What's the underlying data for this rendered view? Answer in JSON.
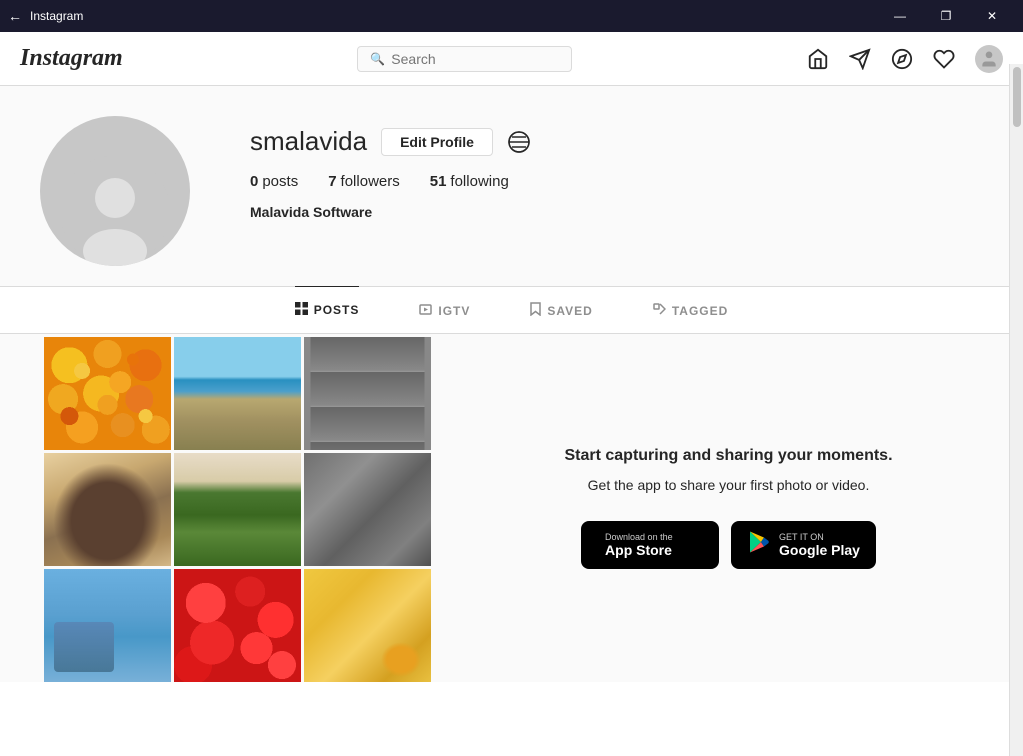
{
  "titleBar": {
    "appName": "Instagram",
    "backLabel": "←",
    "minimizeLabel": "—",
    "maximizeLabel": "❐",
    "closeLabel": "✕"
  },
  "topNav": {
    "logo": "Instagram",
    "search": {
      "placeholder": "Search",
      "value": ""
    },
    "icons": {
      "home": "⌂",
      "send": "▽",
      "explore": "◎",
      "heart": "♡"
    }
  },
  "profile": {
    "username": "smalavida",
    "editButton": "Edit Profile",
    "posts": {
      "count": "0",
      "label": "posts"
    },
    "followers": {
      "count": "7",
      "label": "followers"
    },
    "following": {
      "count": "51",
      "label": "following"
    },
    "displayName": "Malavida Software"
  },
  "tabs": {
    "posts": {
      "label": "POSTS",
      "icon": "⊞"
    },
    "igtv": {
      "label": "IGTV",
      "icon": "▶"
    },
    "saved": {
      "label": "SAVED",
      "icon": "🔖"
    },
    "tagged": {
      "label": "TAGGED",
      "icon": "🏷"
    }
  },
  "appSection": {
    "tagline": "Start capturing and sharing your moments.",
    "subtitle": "Get the app to share your first photo or video.",
    "appStore": {
      "topText": "Download on the",
      "mainText": "App Store"
    },
    "googlePlay": {
      "topText": "GET IT ON",
      "mainText": "Google Play"
    }
  }
}
